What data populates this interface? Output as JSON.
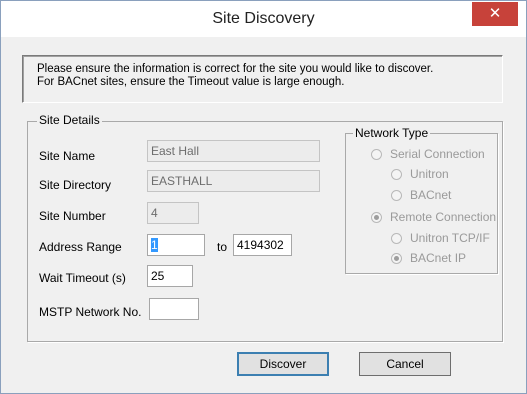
{
  "window": {
    "title": "Site Discovery",
    "close_glyph": "✕"
  },
  "info": {
    "line1": "Please ensure the information is correct for the site you would like to discover.",
    "line2": "For BACnet sites, ensure the Timeout value is large enough."
  },
  "site_details": {
    "legend": "Site Details",
    "site_name_label": "Site Name",
    "site_name_value": "East Hall",
    "site_directory_label": "Site Directory",
    "site_directory_value": "EASTHALL",
    "site_number_label": "Site Number",
    "site_number_value": "4",
    "address_range_label": "Address Range",
    "address_from": "1",
    "address_to_label": "to",
    "address_to": "4194302",
    "wait_timeout_label": "Wait Timeout (s)",
    "wait_timeout_value": "25",
    "mstp_label": "MSTP Network No.",
    "mstp_value": ""
  },
  "network_type": {
    "legend": "Network Type",
    "serial": "Serial Connection",
    "unitron": "Unitron",
    "bacnet": "BACnet",
    "remote": "Remote Connection",
    "unitron_tcp": "Unitron TCP/IF",
    "bacnet_ip": "BACnet IP",
    "selected_primary": "Remote Connection",
    "selected_secondary": "BACnet IP"
  },
  "buttons": {
    "discover": "Discover",
    "cancel": "Cancel"
  },
  "colors": {
    "close_red": "#c7423a",
    "selection_blue": "#3399ff"
  }
}
